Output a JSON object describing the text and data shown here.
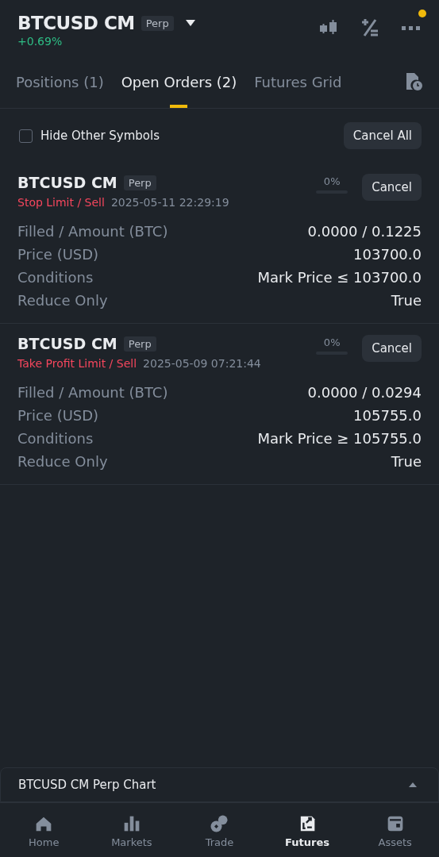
{
  "header": {
    "symbol": "BTCUSD CM",
    "tag": "Perp",
    "change": "+0.69%",
    "notification_dot": true
  },
  "tabs": [
    {
      "label": "Positions (1)",
      "selected": false
    },
    {
      "label": "Open Orders (2)",
      "selected": true
    },
    {
      "label": "Futures Grid",
      "selected": false
    }
  ],
  "filter": {
    "label": "Hide Other Symbols",
    "checked": false,
    "button": "Cancel All"
  },
  "orders": [
    {
      "symbol": "BTCUSD CM",
      "tag": "Perp",
      "type": "Stop Limit / Sell",
      "time": "2025-05-11 22:29:19",
      "progress": "0%",
      "level": 0,
      "button": "Cancel",
      "rows": [
        {
          "label": "Filled / Amount (BTC)",
          "value": "0.0000 / 0.1225"
        },
        {
          "label": "Price (USD)",
          "value": "103700.0"
        },
        {
          "label": "Conditions",
          "value": "Mark Price ≤ 103700.0"
        },
        {
          "label": "Reduce Only",
          "value": "True"
        }
      ]
    },
    {
      "symbol": "BTCUSD CM",
      "tag": "Perp",
      "type": "Take Profit Limit / Sell",
      "time": "2025-05-09 07:21:44",
      "progress": "0%",
      "level": 0,
      "button": "Cancel",
      "rows": [
        {
          "label": "Filled / Amount (BTC)",
          "value": "0.0000 / 0.0294"
        },
        {
          "label": "Price (USD)",
          "value": "105755.0"
        },
        {
          "label": "Conditions",
          "value": "Mark Price ≥ 105755.0"
        },
        {
          "label": "Reduce Only",
          "value": "True"
        }
      ]
    }
  ],
  "chart_bar": {
    "label": "BTCUSD CM Perp Chart"
  },
  "nav": [
    {
      "label": "Home",
      "kind": "home",
      "selected": false
    },
    {
      "label": "Markets",
      "kind": "markets",
      "selected": false
    },
    {
      "label": "Trade",
      "kind": "trade",
      "selected": false
    },
    {
      "label": "Futures",
      "kind": "futures",
      "selected": true
    },
    {
      "label": "Assets",
      "kind": "assets",
      "selected": false
    }
  ]
}
